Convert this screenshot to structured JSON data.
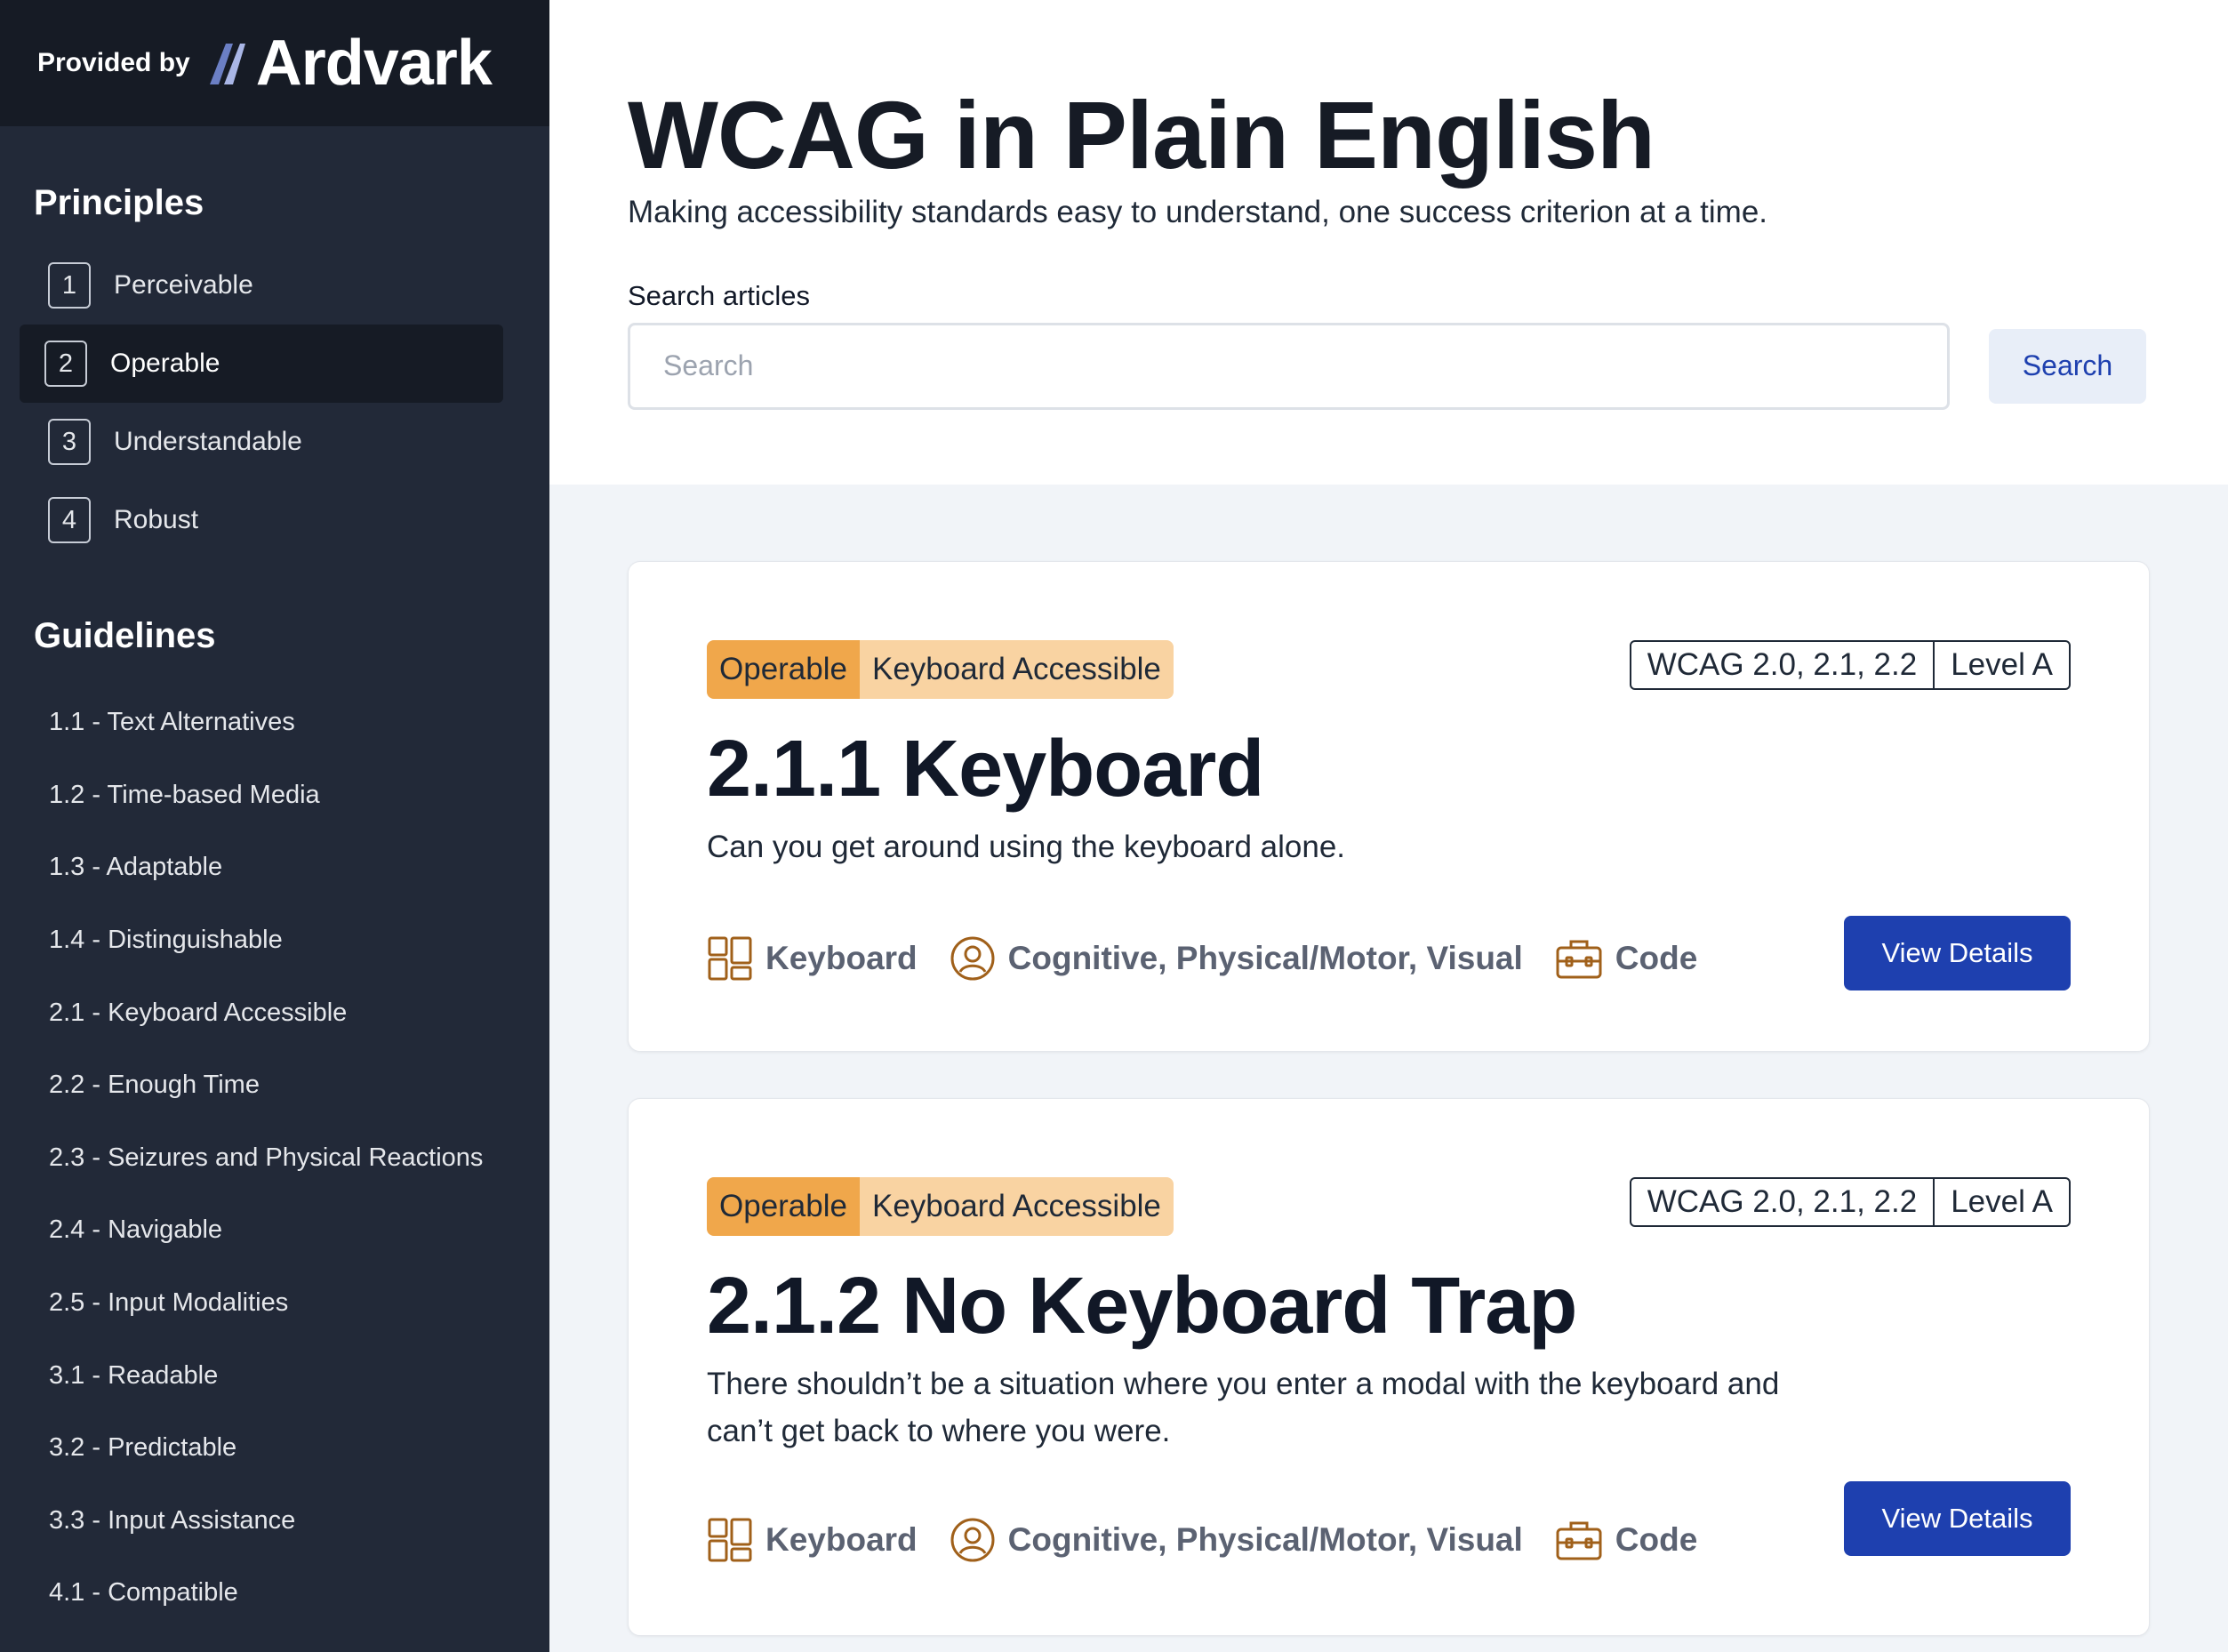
{
  "brand": {
    "provided_by": "Provided by",
    "logo_text": "Ardvark"
  },
  "sidebar": {
    "principles_title": "Principles",
    "principles": [
      {
        "num": "1",
        "label": "Perceivable",
        "active": false
      },
      {
        "num": "2",
        "label": "Operable",
        "active": true
      },
      {
        "num": "3",
        "label": "Understandable",
        "active": false
      },
      {
        "num": "4",
        "label": "Robust",
        "active": false
      }
    ],
    "guidelines_title": "Guidelines",
    "guidelines": [
      "1.1 - Text Alternatives",
      "1.2 - Time-based Media",
      "1.3 - Adaptable",
      "1.4 - Distinguishable",
      "2.1 - Keyboard Accessible",
      "2.2 - Enough Time",
      "2.3 - Seizures and Physical Reactions",
      "2.4 - Navigable",
      "2.5 - Input Modalities",
      "3.1 - Readable",
      "3.2 - Predictable",
      "3.3 - Input Assistance",
      "4.1 - Compatible"
    ]
  },
  "header": {
    "title": "WCAG in Plain English",
    "subtitle": "Making accessibility standards easy to understand, one success criterion at a time.",
    "search_label": "Search articles",
    "search_placeholder": "Search",
    "search_value": "",
    "search_button": "Search"
  },
  "cards": [
    {
      "principle_tag": "Operable",
      "guideline_tag": "Keyboard Accessible",
      "versions": "WCAG 2.0, 2.1, 2.2",
      "level": "Level A",
      "title": "2.1.1 Keyboard",
      "description": "Can you get around using the keyboard alone.",
      "meta_input": "Keyboard",
      "meta_users": "Cognitive, Physical/Motor, Visual",
      "meta_role": "Code",
      "button": "View Details"
    },
    {
      "principle_tag": "Operable",
      "guideline_tag": "Keyboard Accessible",
      "versions": "WCAG 2.0, 2.1, 2.2",
      "level": "Level A",
      "title": "2.1.2 No Keyboard Trap",
      "description": "There shouldn’t be a situation where you enter a modal with the keyboard and can’t get back to where you were.",
      "meta_input": "Keyboard",
      "meta_users": "Cognitive, Physical/Motor, Visual",
      "meta_role": "Code",
      "button": "View Details"
    }
  ],
  "colors": {
    "sidebar_bg": "#222938",
    "brand_bg": "#161b25",
    "accent_blue": "#1e40af",
    "tag_principle": "#f0a74b",
    "tag_guideline": "#f9d3a2",
    "icon_brown": "#a0601a"
  },
  "icons": {
    "input": "keyboard-layout-icon",
    "users": "user-circle-icon",
    "role": "toolbox-icon"
  }
}
